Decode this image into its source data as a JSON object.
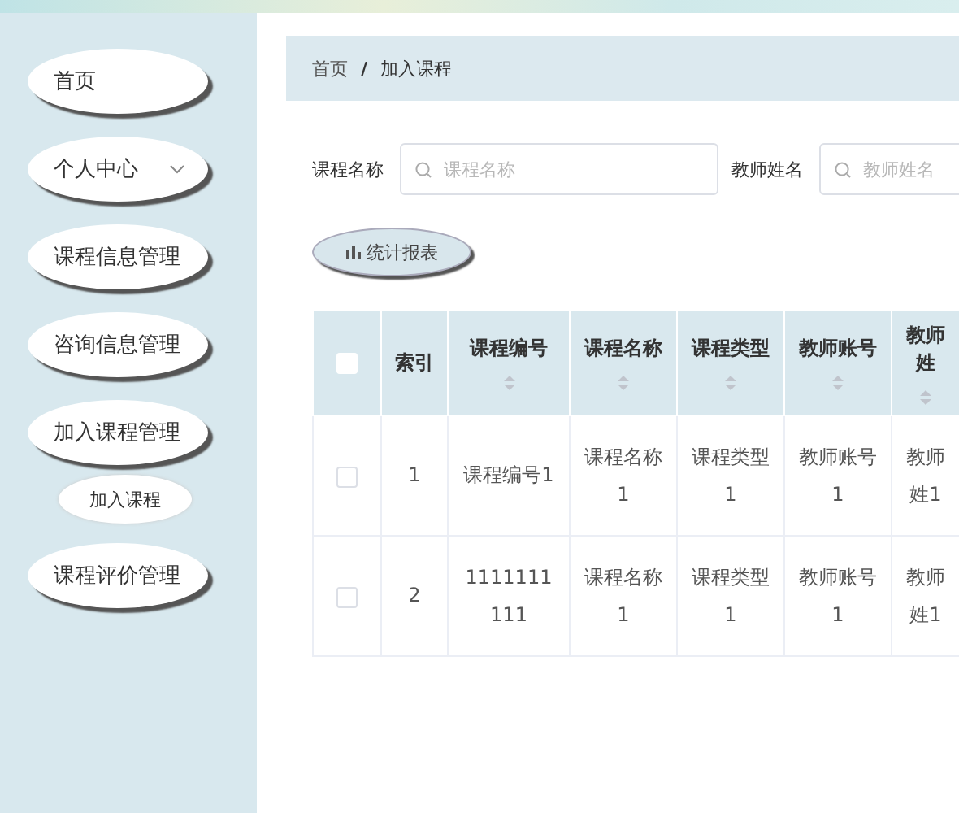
{
  "sidebar": {
    "items": [
      {
        "label": "首页",
        "kind": "link"
      },
      {
        "label": "个人中心",
        "kind": "dropdown"
      },
      {
        "label": "课程信息管理",
        "kind": "link"
      },
      {
        "label": "咨询信息管理",
        "kind": "link"
      },
      {
        "label": "加入课程管理",
        "kind": "link",
        "children": [
          {
            "label": "加入课程"
          }
        ]
      },
      {
        "label": "课程评价管理",
        "kind": "link"
      }
    ]
  },
  "breadcrumb": {
    "items": [
      "首页",
      "加入课程"
    ],
    "separator": "/"
  },
  "search": [
    {
      "label": "课程名称",
      "placeholder": "课程名称"
    },
    {
      "label": "教师姓名",
      "placeholder": "教师姓名"
    }
  ],
  "buttons": [
    {
      "label": "统计报表"
    }
  ],
  "table": {
    "select_all": {
      "checked": false
    },
    "columns": [
      {
        "label": "索引",
        "sortable": false
      },
      {
        "label": "课程编号",
        "sortable": true
      },
      {
        "label": "课程名称",
        "sortable": true
      },
      {
        "label": "课程类型",
        "sortable": true
      },
      {
        "label": "教师账号",
        "sortable": true
      },
      {
        "label": "教师姓",
        "sortable": true
      }
    ],
    "rows": [
      {
        "checked": false,
        "cells": [
          "1",
          "课程编号1",
          "课程名称1",
          "课程类型1",
          "教师账号1",
          "教师姓1"
        ]
      },
      {
        "checked": false,
        "cells": [
          "2",
          "1111111111",
          "课程名称1",
          "课程类型1",
          "教师账号1",
          "教师姓1"
        ]
      }
    ]
  }
}
